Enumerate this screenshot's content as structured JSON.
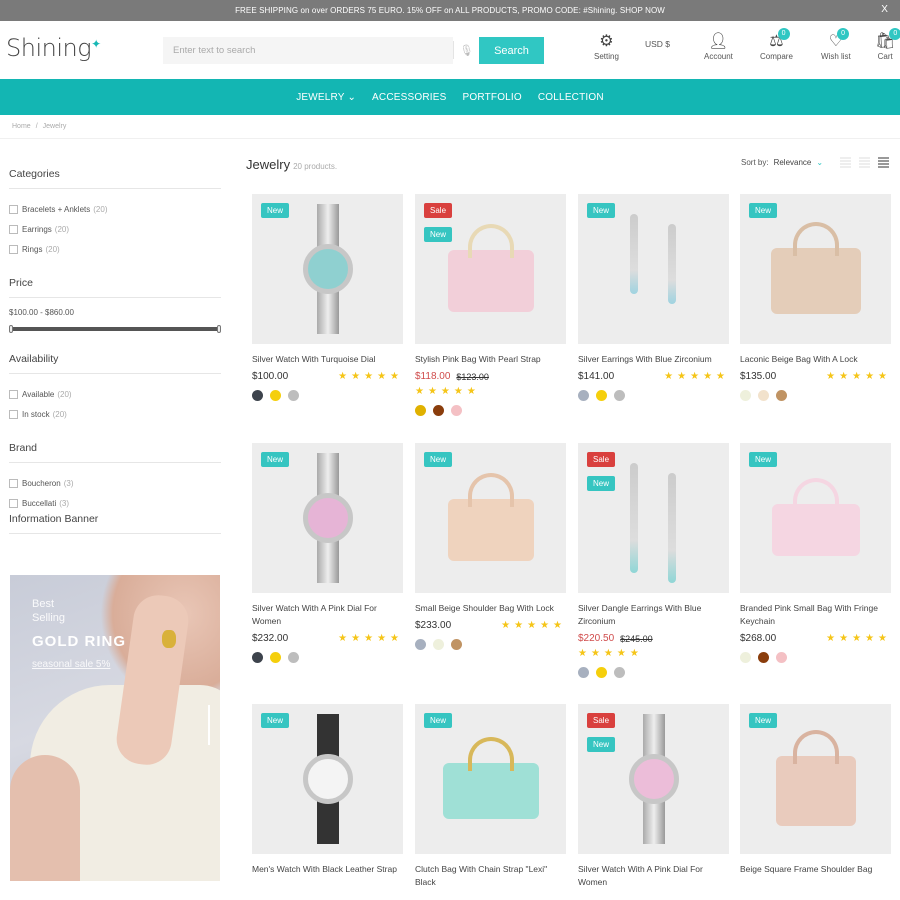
{
  "announcement": {
    "text": "FREE SHIPPING on over ORDERS 75 EURO. 15% OFF on ALL PRODUCTS, PROMO CODE: #Shining. SHOP NOW",
    "close": "X"
  },
  "header": {
    "logo": "Shining",
    "search": {
      "placeholder": "Enter text to search",
      "button": "Search"
    },
    "setting": "Setting",
    "currency": "USD $",
    "account": "Account",
    "compare": {
      "label": "Compare",
      "count": "0"
    },
    "wishlist": {
      "label": "Wish list",
      "count": "0"
    },
    "cart": {
      "label": "Cart",
      "count": "0"
    }
  },
  "nav": {
    "items": [
      {
        "label": "JEWELRY ⌄"
      },
      {
        "label": "ACCESSORIES"
      },
      {
        "label": "PORTFOLIO"
      },
      {
        "label": "COLLECTION"
      }
    ]
  },
  "breadcrumb": {
    "items": [
      "Home",
      "Jewelry"
    ],
    "sep": "/"
  },
  "sidebar": {
    "categories": {
      "title": "Categories",
      "items": [
        {
          "label": "Bracelets + Anklets",
          "count": "(20)"
        },
        {
          "label": "Earrings",
          "count": "(20)"
        },
        {
          "label": "Rings",
          "count": "(20)"
        }
      ]
    },
    "price": {
      "title": "Price",
      "range": "$100.00 - $860.00",
      "min": 100,
      "max": 860
    },
    "availability": {
      "title": "Availability",
      "items": [
        {
          "label": "Available",
          "count": "(20)"
        },
        {
          "label": "In stock",
          "count": "(20)"
        }
      ]
    },
    "brand": {
      "title": "Brand",
      "items": [
        {
          "label": "Boucheron",
          "count": "(3)"
        },
        {
          "label": "Buccellati",
          "count": "(3)"
        }
      ]
    },
    "banner": {
      "title": "Information Banner",
      "line1": "Best",
      "line2": "Selling",
      "headline": "GOLD RING",
      "link": "seasonal sale 5%"
    }
  },
  "listing": {
    "title": "Jewelry",
    "count": "20 products.",
    "sort_label": "Sort by:",
    "sort_value": "Relevance"
  },
  "products": [
    {
      "name": "Silver Watch With Turquoise Dial",
      "price": "$100.00",
      "old_price": "",
      "tags": [
        "New"
      ],
      "rating": 5,
      "swatches": [
        "#3d434c",
        "#f5cf0c",
        "#bdbdbd"
      ]
    },
    {
      "name": "Stylish Pink Bag With Pearl Strap",
      "price": "$118.00",
      "old_price": "$123.00",
      "tags": [
        "Sale",
        "New"
      ],
      "rating": 5,
      "swatches": [
        "#e0b100",
        "#8a3d0c",
        "#f4c0c4"
      ]
    },
    {
      "name": "Silver Earrings With Blue Zirconium",
      "price": "$141.00",
      "old_price": "",
      "tags": [
        "New"
      ],
      "rating": 5,
      "swatches": [
        "#a7b0bf",
        "#f5cf0c",
        "#bdbdbd"
      ]
    },
    {
      "name": "Laconic Beige Bag With A Lock",
      "price": "$135.00",
      "old_price": "",
      "tags": [
        "New"
      ],
      "rating": 5,
      "swatches": [
        "#eef0dc",
        "#f2e2cc",
        "#c09363"
      ]
    },
    {
      "name": "Silver Watch With A Pink Dial For Women",
      "price": "$232.00",
      "old_price": "",
      "tags": [
        "New"
      ],
      "rating": 5,
      "swatches": [
        "#3d434c",
        "#f5cf0c",
        "#bdbdbd"
      ]
    },
    {
      "name": "Small Beige Shoulder Bag With Lock",
      "price": "$233.00",
      "old_price": "",
      "tags": [
        "New"
      ],
      "rating": 5,
      "swatches": [
        "#a7b0bf",
        "#eef0dc",
        "#c09363"
      ]
    },
    {
      "name": "Silver Dangle Earrings With Blue Zirconium",
      "price": "$220.50",
      "old_price": "$245.00",
      "tags": [
        "Sale",
        "New"
      ],
      "rating": 5,
      "swatches": [
        "#a7b0bf",
        "#f5cf0c",
        "#bdbdbd"
      ]
    },
    {
      "name": "Branded Pink Small Bag With Fringe Keychain",
      "price": "$268.00",
      "old_price": "",
      "tags": [
        "New"
      ],
      "rating": 5,
      "swatches": [
        "#eef0dc",
        "#8a3d0c",
        "#f4c0c4"
      ]
    },
    {
      "name": "Men's Watch With Black Leather Strap",
      "price": "",
      "old_price": "",
      "tags": [
        "New"
      ],
      "rating": 0,
      "swatches": []
    },
    {
      "name": "Clutch Bag With Chain Strap \"Lexi\" Black",
      "price": "",
      "old_price": "",
      "tags": [
        "New"
      ],
      "rating": 0,
      "swatches": []
    },
    {
      "name": "Silver Watch With A Pink Dial For Women",
      "price": "",
      "old_price": "",
      "tags": [
        "Sale",
        "New"
      ],
      "rating": 0,
      "swatches": []
    },
    {
      "name": "Beige Square Frame Shoulder Bag",
      "price": "",
      "old_price": "",
      "tags": [
        "New"
      ],
      "rating": 0,
      "swatches": []
    }
  ],
  "colors": {
    "accent": "#13b6b3",
    "sale": "#d9403e",
    "new": "#36c5c1",
    "star": "#f5c518"
  }
}
